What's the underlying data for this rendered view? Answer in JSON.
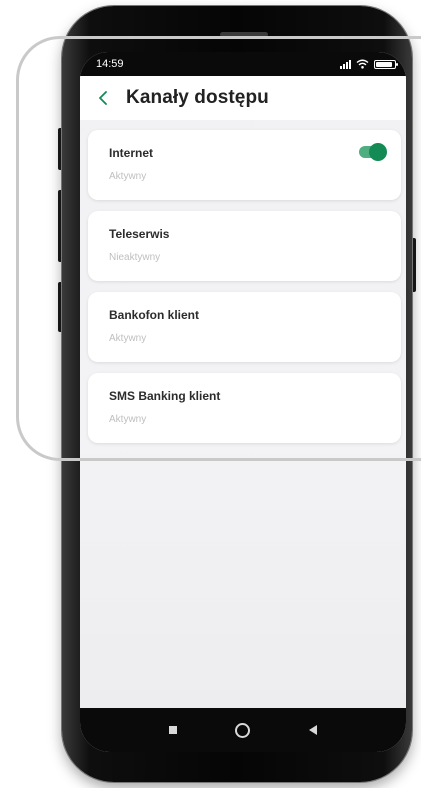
{
  "status_bar": {
    "time": "14:59"
  },
  "header": {
    "title": "Kanały dostępu"
  },
  "channels": [
    {
      "name": "Internet",
      "status": "Aktywny",
      "toggle_on": true
    },
    {
      "name": "Teleserwis",
      "status": "Nieaktywny"
    },
    {
      "name": "Bankofon klient",
      "status": "Aktywny"
    },
    {
      "name": "SMS Banking klient",
      "status": "Aktywny"
    }
  ],
  "colors": {
    "toggle_on": "#148a55",
    "toggle_track": "#4fae7f",
    "header_text": "#222222",
    "status_text": "#bfbfbf"
  }
}
